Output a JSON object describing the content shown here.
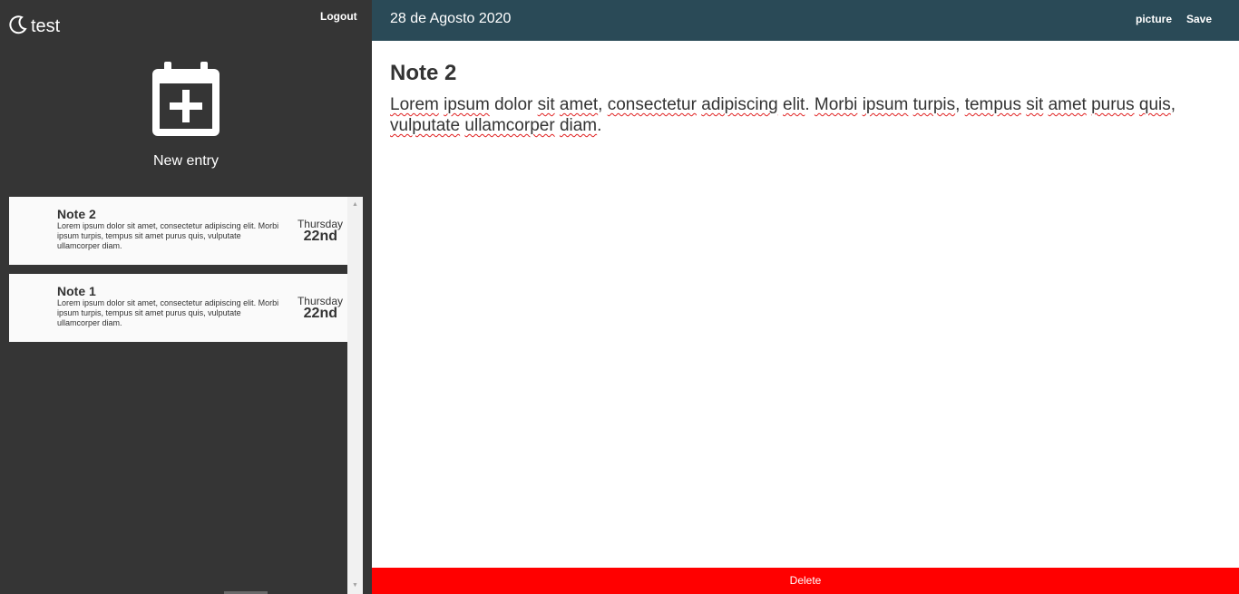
{
  "app": {
    "name": "test"
  },
  "sidebar": {
    "logout_label": "Logout",
    "new_entry_label": "New entry",
    "notes": [
      {
        "title": "Note 2",
        "preview": "Lorem ipsum dolor sit amet, consectetur adipiscing elit. Morbi ipsum turpis, tempus sit amet purus quis, vulputate ullamcorper diam.",
        "day": "Thursday",
        "date": "22nd"
      },
      {
        "title": "Note 1",
        "preview": "Lorem ipsum dolor sit amet, consectetur adipiscing elit. Morbi ipsum turpis, tempus sit amet purus quis, vulputate ullamcorper diam.",
        "day": "Thursday",
        "date": "22nd"
      }
    ]
  },
  "header": {
    "date_title": "28 de Agosto 2020",
    "picture_label": "picture",
    "save_label": "Save"
  },
  "editor": {
    "title": "Note 2",
    "body_words": [
      "Lorem",
      "ipsum",
      "dolor",
      "sit",
      "amet,",
      "consectetur",
      "adipiscing",
      "elit.",
      "Morbi",
      "ipsum",
      "turpis,",
      "tempus",
      "sit",
      "amet",
      "purus",
      "quis,",
      "vulputate",
      "ullamcorper",
      "diam."
    ],
    "misspelled_flags": [
      1,
      1,
      0,
      1,
      1,
      1,
      1,
      1,
      1,
      1,
      1,
      1,
      1,
      1,
      1,
      1,
      1,
      1,
      1
    ]
  },
  "footer": {
    "delete_label": "Delete"
  },
  "colors": {
    "sidebar_bg": "#353535",
    "header_bg": "#2a4a57",
    "card_bg": "#fafafa",
    "delete_bg": "#ff0000",
    "spellcheck_underline": "#e02020"
  },
  "icons": [
    "moon-icon",
    "calendar-plus-icon",
    "scroll-up-arrow-icon",
    "scroll-down-arrow-icon"
  ]
}
